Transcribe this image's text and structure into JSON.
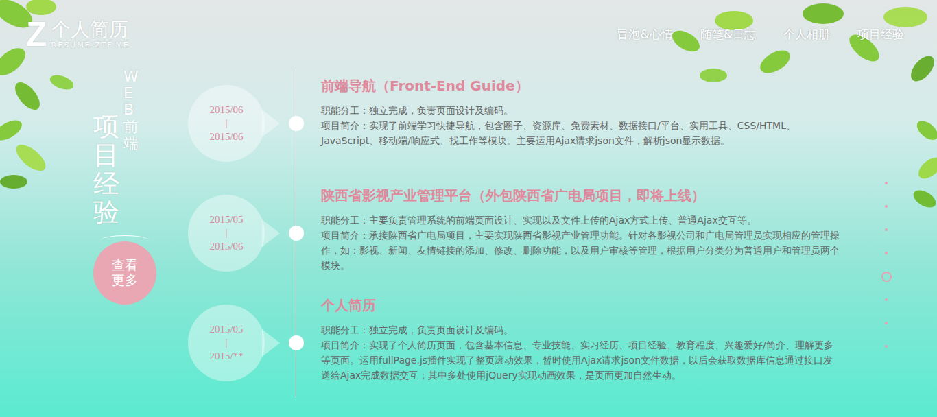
{
  "logo": {
    "mark": "Z",
    "title": "个人简历",
    "subtitle": "RESUME.ZTF.ME"
  },
  "nav": [
    {
      "label": "冒泡&心情"
    },
    {
      "label": "随笔&日志"
    },
    {
      "label": "个人相册"
    },
    {
      "label": "项目经验"
    }
  ],
  "section": {
    "title": "项目经验",
    "subtitle": "WEB前端",
    "more_button": "查看更多"
  },
  "projects": [
    {
      "start": "2015/06",
      "separator": "|",
      "end": "2015/06",
      "title": "前端导航（Front-End Guide）",
      "role": "职能分工：独立完成，负责页面设计及编码。",
      "intro": "项目简介：实现了前端学习快捷导航，包含圈子、资源库、免费素材、数据接口/平台、实用工具、CSS/HTML、JavaScript、移动端/响应式、找工作等模块。主要运用Ajax请求json文件，解析json显示数据。"
    },
    {
      "start": "2015/05",
      "separator": "|",
      "end": "2015/06",
      "title": "陕西省影视产业管理平台（外包陕西省广电局项目，即将上线）",
      "role": "职能分工：主要负责管理系统的前端页面设计、实现以及文件上传的Ajax方式上传、普通Ajax交互等。",
      "intro": "项目简介：承接陕西省广电局项目，主要实现陕西省影视产业管理功能。针对各影视公司和广电局管理员实现相应的管理操作，如：影视、新闻、友情链接的添加、修改、删除功能，以及用户审核等管理，根据用户分类分为普通用户和管理员两个模块。"
    },
    {
      "start": "2015/05",
      "separator": "|",
      "end": "2015/**",
      "title": "个人简历",
      "role": "职能分工：独立完成，负责页面设计及编码。",
      "intro": "项目简介：实现了个人简历页面，包含基本信息、专业技能、实习经历、项目经验、教育程度、兴趣爱好/简介、理解更多等页面。运用fullPage.js插件实现了整页滚动效果，暂时使用Ajax请求json文件数据，以后会获取数据库信息通过接口发送给Ajax完成数据交互；其中多处使用jQuery实现动画效果，是页面更加自然生动。"
    }
  ],
  "page_dots": [
    {
      "selected": false
    },
    {
      "selected": false
    },
    {
      "selected": false
    },
    {
      "selected": false
    },
    {
      "selected": true
    },
    {
      "selected": false
    },
    {
      "selected": false
    },
    {
      "selected": false
    }
  ]
}
